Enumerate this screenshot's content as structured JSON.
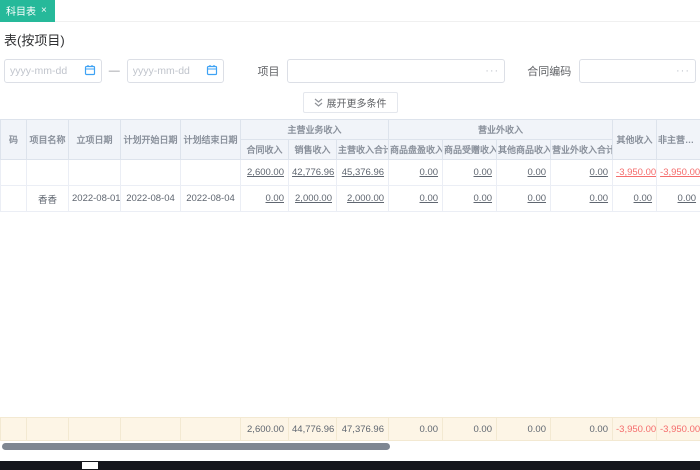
{
  "tabs": {
    "active": {
      "label": "科目表",
      "close": "×"
    }
  },
  "page": {
    "title": "表(按项目)"
  },
  "filters": {
    "date_start_placeholder": "yyyy-mm-dd",
    "date_separator": "—",
    "date_end_placeholder": "yyyy-mm-dd",
    "project_label": "项目",
    "project_more": "···",
    "contract_label": "合同编码",
    "contract_more": "···",
    "expand_more": "展开更多条件"
  },
  "table": {
    "headers": [
      "码",
      "项目名称",
      "立项日期",
      "计划开始日期",
      "计划结束日期",
      "其他收入",
      "非主营收入合计"
    ],
    "groups": [
      {
        "label": "主营业务收入",
        "children": [
          "合同收入",
          "销售收入",
          "主营收入合计"
        ]
      },
      {
        "label": "营业外收入",
        "children": [
          "商品盘盈收入",
          "商品受赠收入",
          "其他商品收入",
          "营业外收入合计"
        ]
      }
    ],
    "rows": [
      {
        "code": "",
        "name": "",
        "start_date": "",
        "plan_start": "",
        "plan_end": "",
        "values": [
          "2,600.00",
          "42,776.96",
          "45,376.96",
          "0.00",
          "0.00",
          "0.00",
          "0.00",
          "-3,950.00",
          "-3,950.00"
        ]
      },
      {
        "code": "",
        "name": "香香",
        "start_date": "2022-08-01",
        "plan_start": "2022-08-04",
        "plan_end": "2022-08-04",
        "values": [
          "0.00",
          "2,000.00",
          "2,000.00",
          "0.00",
          "0.00",
          "0.00",
          "0.00",
          "0.00",
          "0.00"
        ]
      }
    ],
    "footer": {
      "values": [
        "2,600.00",
        "44,776.96",
        "47,376.96",
        "0.00",
        "0.00",
        "0.00",
        "0.00",
        "-3,950.00",
        "-3,950.00"
      ]
    }
  }
}
